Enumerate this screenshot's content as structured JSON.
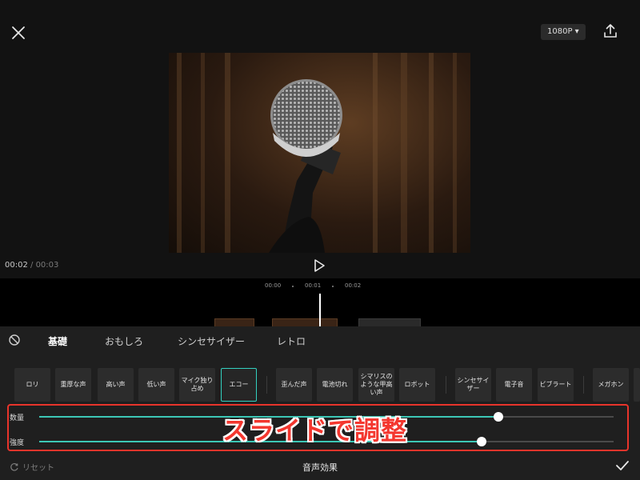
{
  "header": {
    "resolution": "1080P",
    "resolution_caret": "▾"
  },
  "player": {
    "current_time": "00:02",
    "separator": " / ",
    "total_time": "00:03"
  },
  "timeline": {
    "ticks": [
      "00:00",
      "00:01",
      "00:02"
    ]
  },
  "tabs": [
    {
      "label": "基礎",
      "active": true
    },
    {
      "label": "おもしろ",
      "active": false
    },
    {
      "label": "シンセサイザー",
      "active": false
    },
    {
      "label": "レトロ",
      "active": false
    }
  ],
  "effects": [
    "ロリ",
    "重厚な声",
    "高い声",
    "低い声",
    "マイク独り占め",
    "エコー",
    "歪んだ声",
    "電池切れ",
    "シマリスのような甲高い声",
    "ロボット",
    "シンセサイザー",
    "電子音",
    "ビブラート",
    "メガホン"
  ],
  "selected_effect": "エコー",
  "sliders": [
    {
      "label": "数量",
      "value": 0.8
    },
    {
      "label": "強度",
      "value": 0.77
    }
  ],
  "overlay_caption": "スライドで調整",
  "footer": {
    "reset_label": "リセット",
    "title": "音声効果"
  },
  "colors": {
    "accent": "#3cc7b6",
    "highlight": "#e8342b",
    "background": "#121212",
    "panel": "#1f1f1f"
  }
}
